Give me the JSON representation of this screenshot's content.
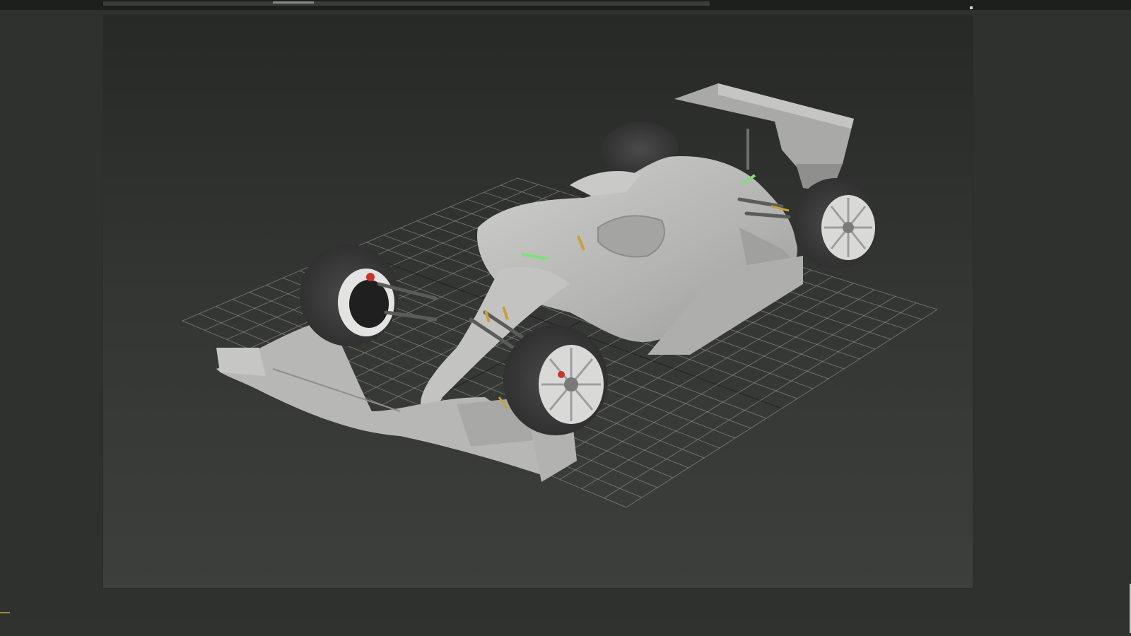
{
  "app": {
    "name": "3D viewport"
  },
  "viewport": {
    "content": "formula-one-car-model",
    "progress": 0.3
  },
  "colors": {
    "background": "#2f312f",
    "viewport_top": "#272927",
    "viewport_bottom": "#3d3f3c",
    "grid": "#9a9c98",
    "body": "#b8b9b6",
    "tire": "#3a3b3a",
    "rim": "#d9dad8",
    "accent_green": "#7ee07a",
    "accent_yellow": "#c9a13a",
    "brake_red": "#c8342c"
  }
}
